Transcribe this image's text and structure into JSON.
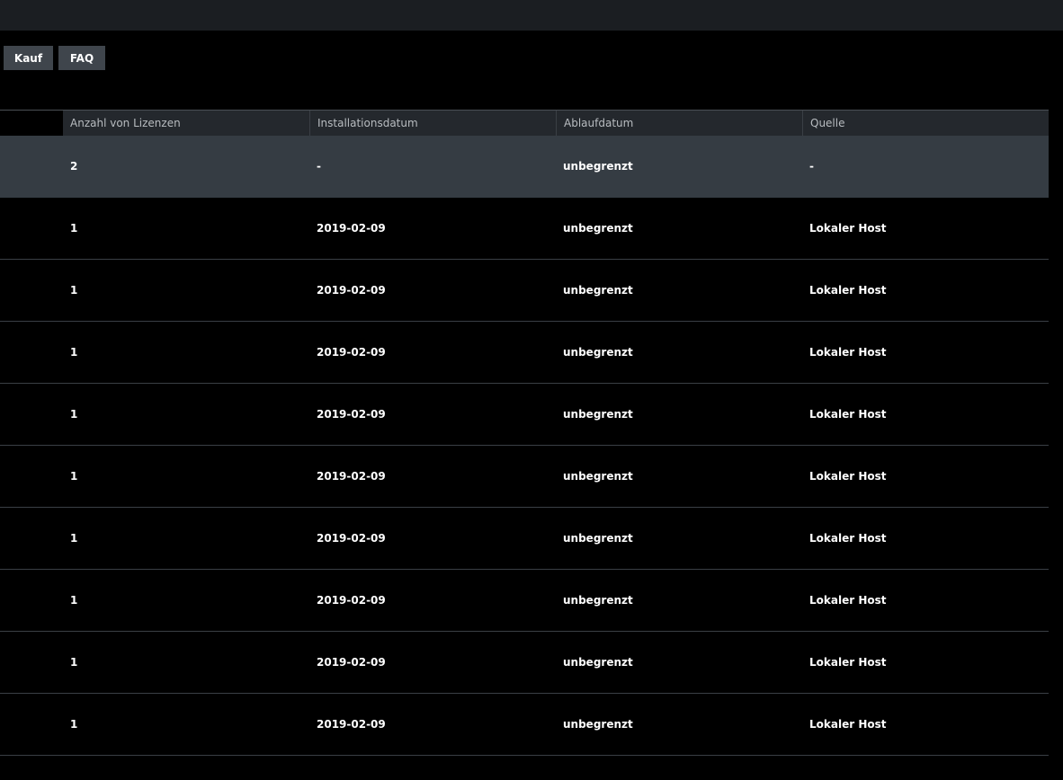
{
  "toolbar": {
    "buttons": [
      {
        "label": "Kauf"
      },
      {
        "label": "FAQ"
      }
    ]
  },
  "table": {
    "columns": [
      "Anzahl von Lizenzen",
      "Installationsdatum",
      "Ablaufdatum",
      "Quelle"
    ],
    "rows": [
      {
        "count": "2",
        "installed": "-",
        "expires": "unbegrenzt",
        "source": "-",
        "selected": true
      },
      {
        "count": "1",
        "installed": "2019-02-09",
        "expires": "unbegrenzt",
        "source": "Lokaler Host"
      },
      {
        "count": "1",
        "installed": "2019-02-09",
        "expires": "unbegrenzt",
        "source": "Lokaler Host"
      },
      {
        "count": "1",
        "installed": "2019-02-09",
        "expires": "unbegrenzt",
        "source": "Lokaler Host"
      },
      {
        "count": "1",
        "installed": "2019-02-09",
        "expires": "unbegrenzt",
        "source": "Lokaler Host"
      },
      {
        "count": "1",
        "installed": "2019-02-09",
        "expires": "unbegrenzt",
        "source": "Lokaler Host"
      },
      {
        "count": "1",
        "installed": "2019-02-09",
        "expires": "unbegrenzt",
        "source": "Lokaler Host"
      },
      {
        "count": "1",
        "installed": "2019-02-09",
        "expires": "unbegrenzt",
        "source": "Lokaler Host"
      },
      {
        "count": "1",
        "installed": "2019-02-09",
        "expires": "unbegrenzt",
        "source": "Lokaler Host"
      },
      {
        "count": "1",
        "installed": "2019-02-09",
        "expires": "unbegrenzt",
        "source": "Lokaler Host"
      }
    ]
  },
  "colors": {
    "background": "#000000",
    "topbar": "#1b1e22",
    "button": "#3f454c",
    "header": "#24282d",
    "selected_row": "#353c43",
    "divider": "#3a3f45"
  }
}
